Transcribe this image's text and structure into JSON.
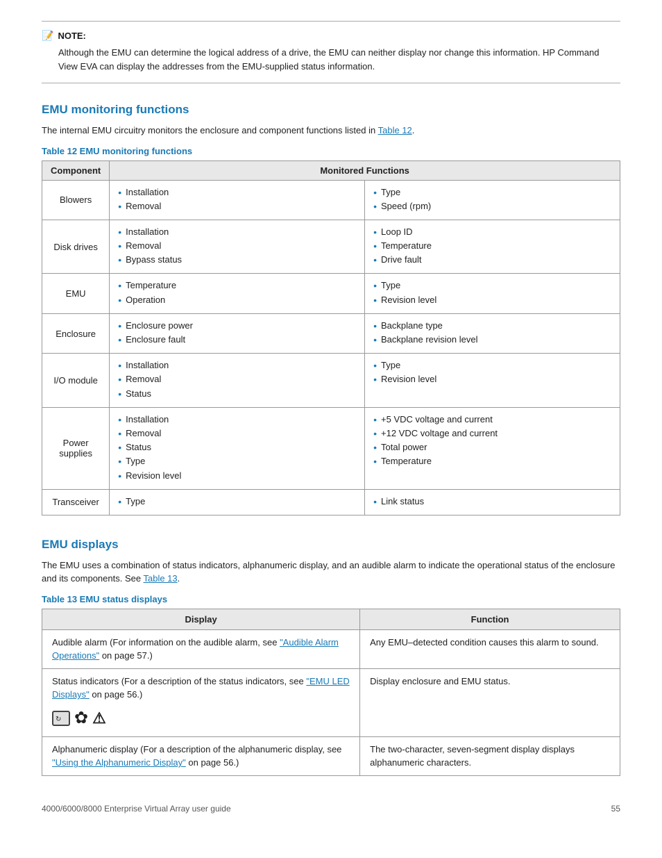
{
  "note": {
    "title": "NOTE:",
    "text": "Although the EMU can determine the logical address of a drive, the EMU can neither display nor change this information.  HP Command View EVA can display the addresses from the EMU-supplied status information."
  },
  "emu_monitoring": {
    "heading": "EMU monitoring functions",
    "intro_text": "The internal EMU circuitry monitors the enclosure and component functions listed in",
    "intro_link": "Table 12",
    "intro_end": ".",
    "table_caption": "Table 12 EMU monitoring functions",
    "table_headers": {
      "component": "Component",
      "monitored": "Monitored  Functions"
    },
    "rows": [
      {
        "component": "Blowers",
        "left": [
          "Installation",
          "Removal"
        ],
        "right": [
          "Type",
          "Speed (rpm)"
        ]
      },
      {
        "component": "Disk drives",
        "left": [
          "Installation",
          "Removal",
          "Bypass status"
        ],
        "right": [
          "Loop ID",
          "Temperature",
          "Drive fault"
        ]
      },
      {
        "component": "EMU",
        "left": [
          "Temperature",
          "Operation"
        ],
        "right": [
          "Type",
          "Revision level"
        ]
      },
      {
        "component": "Enclosure",
        "left": [
          "Enclosure power",
          "Enclosure fault"
        ],
        "right": [
          "Backplane type",
          "Backplane revision level"
        ]
      },
      {
        "component": "I/O  module",
        "left": [
          "Installation",
          "Removal",
          "Status"
        ],
        "right": [
          "Type",
          "Revision level"
        ]
      },
      {
        "component": "Power supplies",
        "left": [
          "Installation",
          "Removal",
          "Status",
          "Type",
          "Revision level"
        ],
        "right": [
          "+5 VDC voltage and current",
          "+12 VDC voltage and current",
          "Total power",
          "Temperature"
        ]
      },
      {
        "component": "Transceiver",
        "left": [
          "Type"
        ],
        "right": [
          "Link status"
        ]
      }
    ]
  },
  "emu_displays": {
    "heading": "EMU displays",
    "intro_text": "The EMU uses a combination of status indicators, alphanumeric display, and an audible alarm to indicate the operational status of the enclosure and its components.  See",
    "intro_link": "Table 13",
    "intro_end": ".",
    "table_caption": "Table 13 EMU status displays",
    "table_headers": {
      "display": "Display",
      "function": "Function"
    },
    "rows": [
      {
        "display_text": "Audible alarm (For information on the audible alarm, see",
        "display_link": "\"Audible Alarm Operations\"",
        "display_link_after": " on page 57.)",
        "function": "Any EMU–detected condition causes this alarm to sound.",
        "has_led": false
      },
      {
        "display_text": "Status indicators (For a description of the status indicators, see",
        "display_link": "\"EMU LED Displays\"",
        "display_link_after": " on page 56.)",
        "function": "Display enclosure and EMU status.",
        "has_led": true
      },
      {
        "display_text": "Alphanumeric display (For a description of the alphanumeric display, see",
        "display_link": "\"Using the Alphanumeric Display\"",
        "display_link_after": " on page 56.)",
        "function": "The two-character, seven-segment display displays alphanumeric characters.",
        "has_led": false
      }
    ]
  },
  "footer": {
    "document_title": "4000/6000/8000 Enterprise Virtual Array user guide",
    "page_number": "55"
  }
}
